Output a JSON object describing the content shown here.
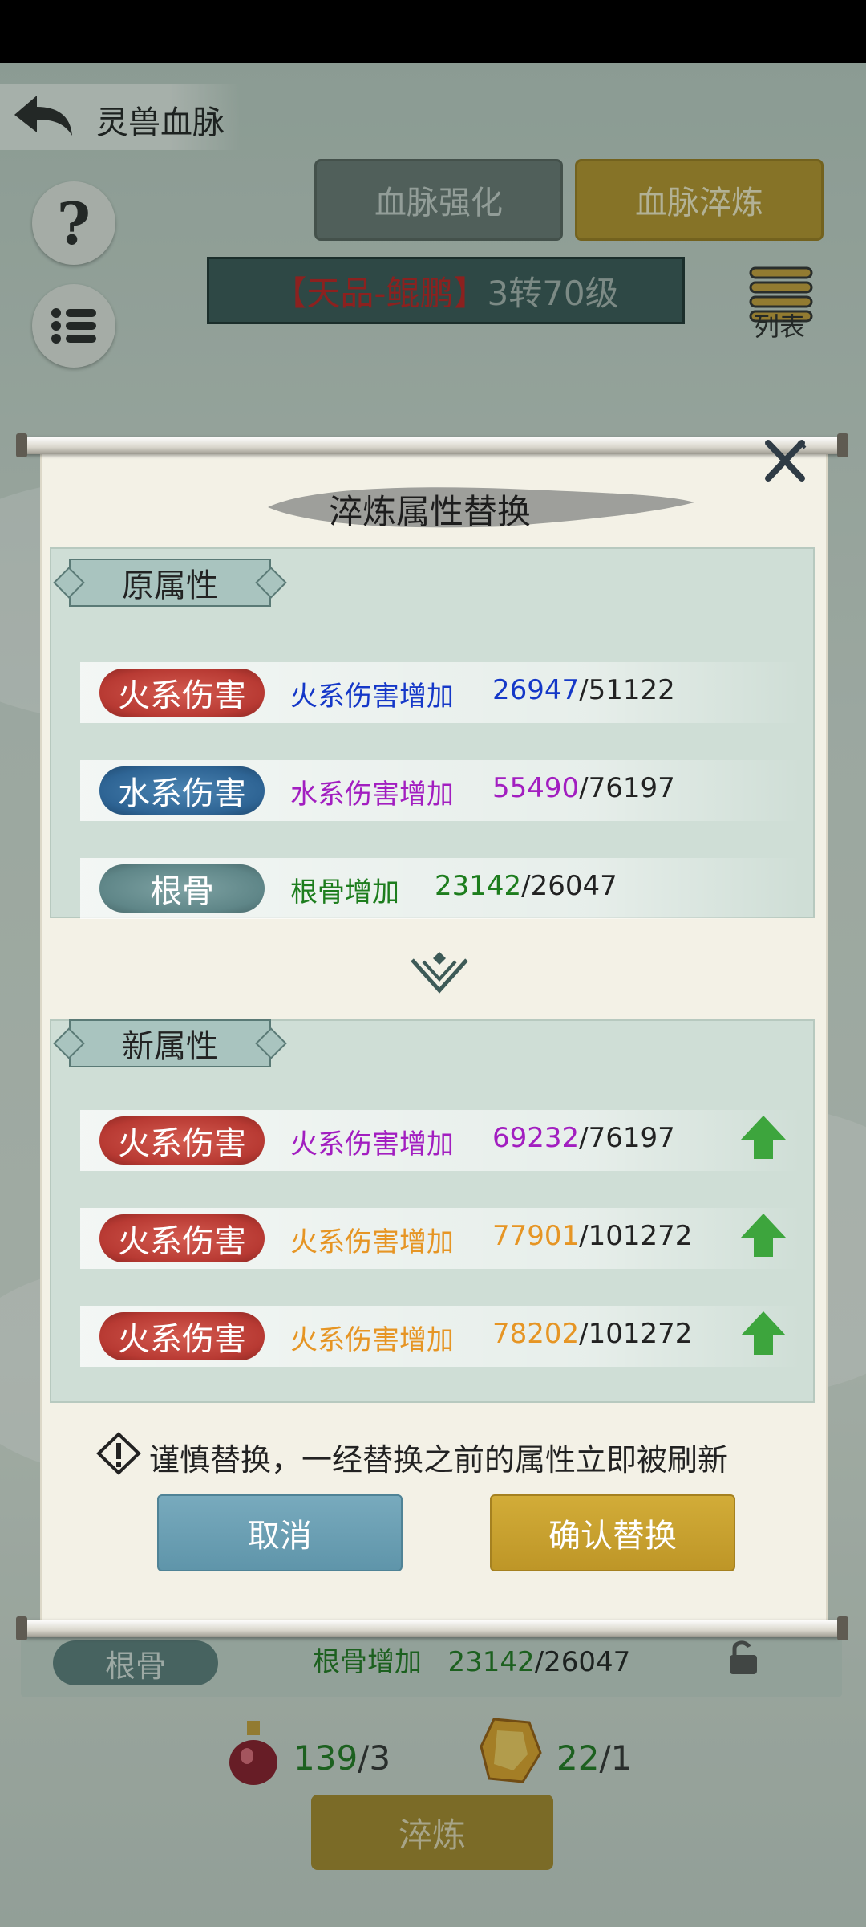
{
  "header": {
    "title": "灵兽血脉"
  },
  "tabs": [
    {
      "label": "血脉强化"
    },
    {
      "label": "血脉淬炼"
    }
  ],
  "pet": {
    "grade": "【天品-鲲鹏】",
    "level": "3转70级"
  },
  "list_button": {
    "label": "列表"
  },
  "dialog": {
    "title": "淬炼属性替换",
    "original_section": "原属性",
    "new_section": "新属性",
    "original_attrs": [
      {
        "badge": "火系伤害",
        "desc": "火系伤害增加",
        "current": "26947",
        "max": "/51122",
        "color": "#1538c8"
      },
      {
        "badge": "水系伤害",
        "desc": "水系伤害增加",
        "current": "55490",
        "max": "/76197",
        "color": "#a21ec0"
      },
      {
        "badge": "根骨",
        "desc": "根骨增加",
        "current": "23142",
        "max": "/26047",
        "color": "#1d7d1d"
      }
    ],
    "new_attrs": [
      {
        "badge": "火系伤害",
        "desc": "火系伤害增加",
        "current": "69232",
        "max": "/76197",
        "color": "#a21ec0"
      },
      {
        "badge": "火系伤害",
        "desc": "火系伤害增加",
        "current": "77901",
        "max": "/101272",
        "color": "#e69524"
      },
      {
        "badge": "火系伤害",
        "desc": "火系伤害增加",
        "current": "78202",
        "max": "/101272",
        "color": "#e69524"
      }
    ],
    "warning": "谨慎替换，一经替换之前的属性立即被刷新",
    "cancel_label": "取消",
    "confirm_label": "确认替换"
  },
  "underlying": {
    "attr_badge": "根骨",
    "attr_desc": "根骨增加",
    "attr_current": "23142",
    "attr_max": "/26047"
  },
  "items": [
    {
      "icon": "potion-icon",
      "current": "139",
      "required": "/3"
    },
    {
      "icon": "crystal-icon",
      "current": "22",
      "required": "/1"
    }
  ],
  "refine_button": {
    "label": "淬炼"
  }
}
